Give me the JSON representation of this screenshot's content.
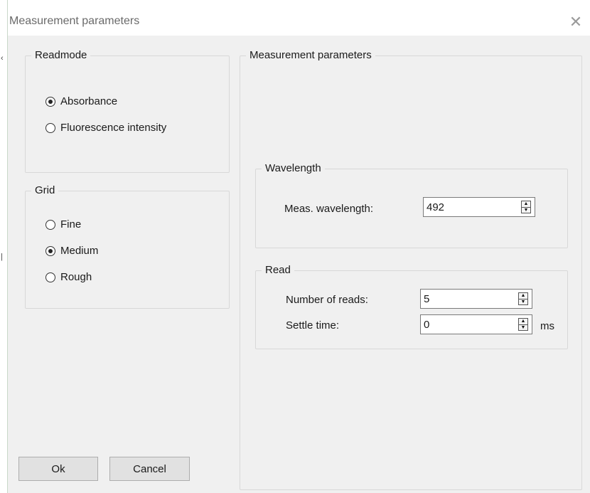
{
  "window": {
    "title": "Measurement parameters",
    "close_glyph": "✕"
  },
  "readmode": {
    "label": "Readmode",
    "options": [
      {
        "label": "Absorbance",
        "checked": true
      },
      {
        "label": "Fluorescence intensity",
        "checked": false
      }
    ]
  },
  "grid": {
    "label": "Grid",
    "options": [
      {
        "label": "Fine",
        "checked": false
      },
      {
        "label": "Medium",
        "checked": true
      },
      {
        "label": "Rough",
        "checked": false
      }
    ]
  },
  "measurement": {
    "label": "Measurement parameters",
    "wavelength": {
      "label": "Wavelength",
      "meas_label": "Meas. wavelength:",
      "meas_value": "492"
    },
    "read": {
      "label": "Read",
      "reads_label": "Number of reads:",
      "reads_value": "5",
      "settle_label": "Settle time:",
      "settle_value": "0",
      "settle_unit": "ms"
    }
  },
  "buttons": {
    "ok": "Ok",
    "cancel": "Cancel"
  },
  "icons": {
    "close": "close-icon",
    "spin_up": "▲",
    "spin_down": "▼"
  }
}
